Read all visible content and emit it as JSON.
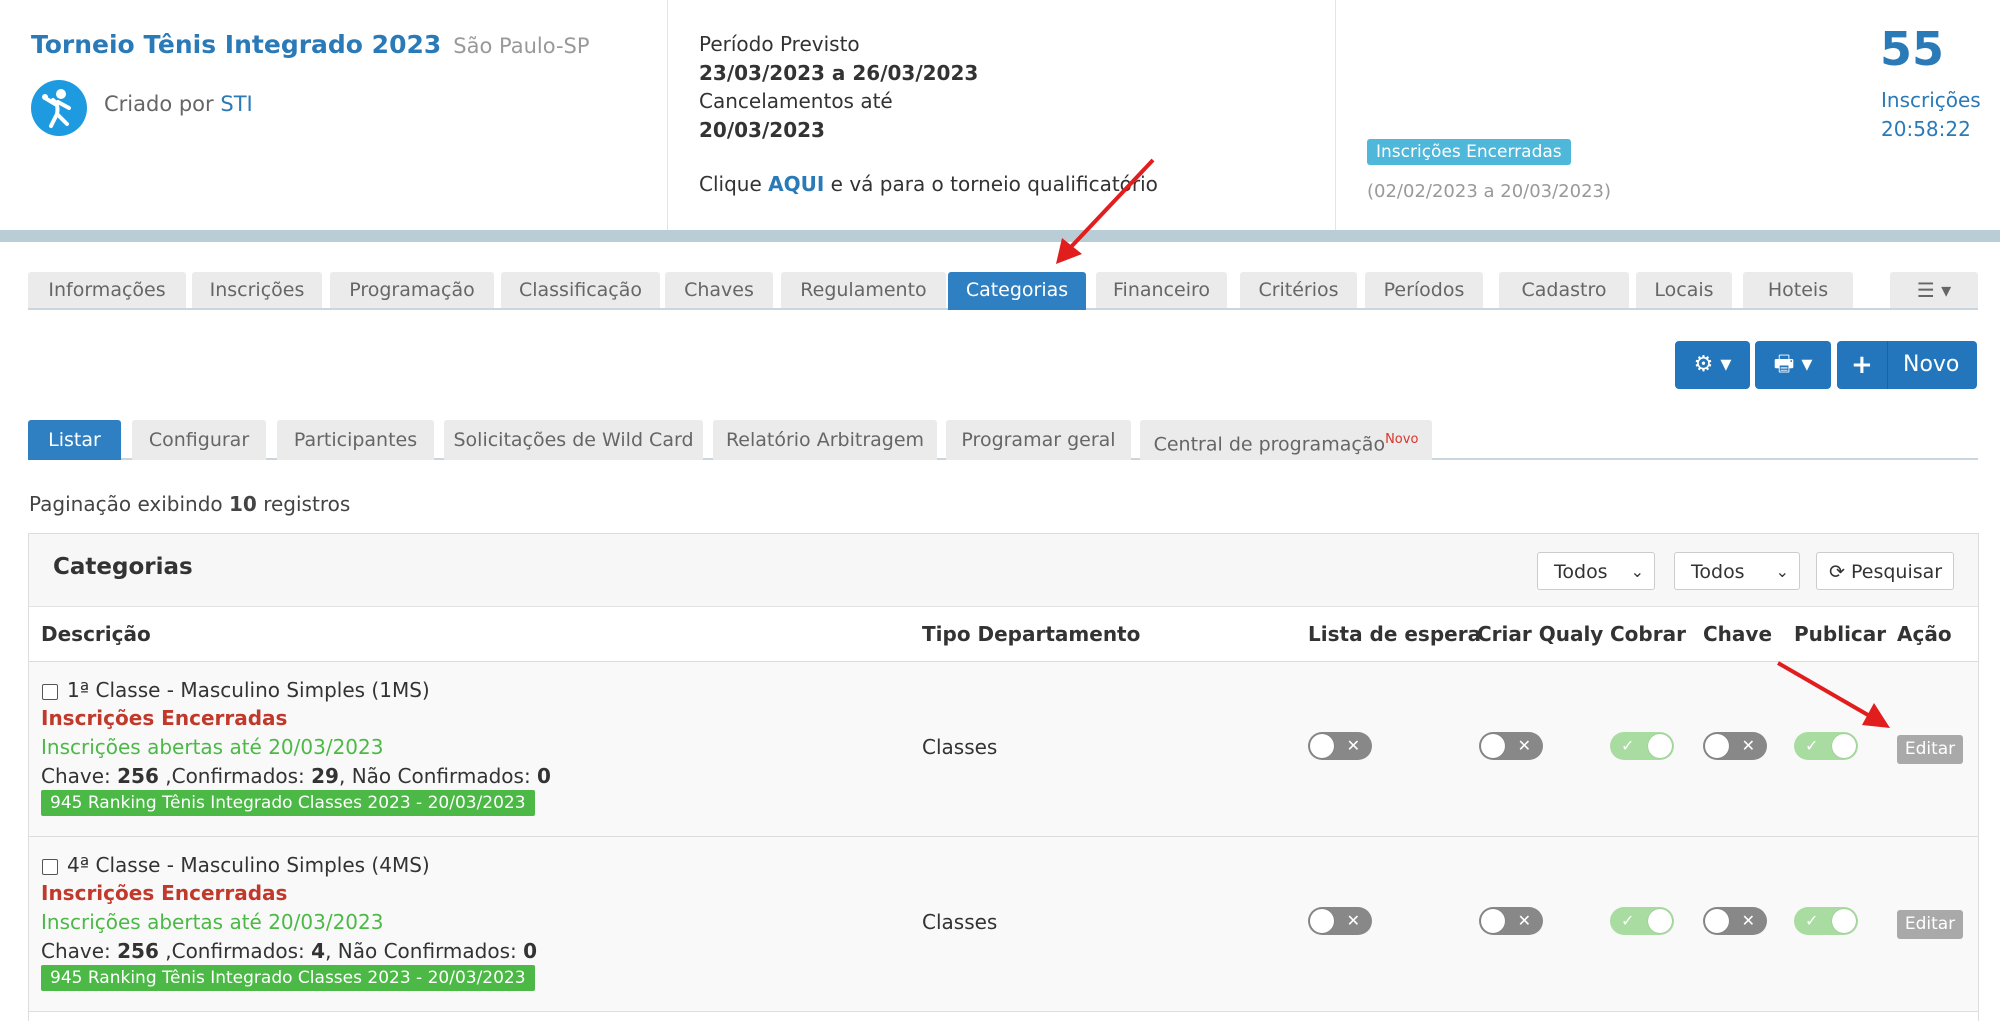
{
  "header": {
    "title": "Torneio Tênis Integrado 2023",
    "city": "São Paulo-SP",
    "created_prefix": "Criado por",
    "created_by": "STI",
    "period_label": "Período Previsto",
    "period_value": "23/03/2023 a 26/03/2023",
    "cancel_label": "Cancelamentos até",
    "cancel_value": "20/03/2023",
    "qualy_prefix": "Clique",
    "qualy_link": "AQUI",
    "qualy_suffix": "e vá para o torneio qualificatório",
    "status_badge": "Inscrições Encerradas",
    "status_range": "(02/02/2023 a 20/03/2023)",
    "registrations_count": "55",
    "registrations_label": "Inscrições",
    "clock": "20:58:22"
  },
  "tabs": [
    {
      "label": "Informações"
    },
    {
      "label": "Inscrições"
    },
    {
      "label": "Programação"
    },
    {
      "label": "Classificação"
    },
    {
      "label": "Chaves"
    },
    {
      "label": "Regulamento"
    },
    {
      "label": "Categorias"
    },
    {
      "label": "Financeiro"
    },
    {
      "label": "Critérios"
    },
    {
      "label": "Períodos"
    },
    {
      "label": "Cadastro"
    },
    {
      "label": "Locais"
    },
    {
      "label": "Hoteis"
    }
  ],
  "menu_tab_icon": "hamburger-menu-icon",
  "actions": {
    "settings_icon": "gear-icon",
    "print_icon": "printer-icon",
    "new_label": "Novo"
  },
  "subtabs": [
    {
      "label": "Listar"
    },
    {
      "label": "Configurar"
    },
    {
      "label": "Participantes"
    },
    {
      "label": "Solicitações de Wild Card"
    },
    {
      "label": "Relatório Arbitragem"
    },
    {
      "label": "Programar geral"
    },
    {
      "label": "Central de programação",
      "badge": "Novo"
    }
  ],
  "pagination": {
    "prefix": "Paginação exibindo",
    "count": "10",
    "suffix": "registros"
  },
  "panel": {
    "title": "Categorias",
    "filter1": "Todos",
    "filter2": "Todos",
    "search_label": "Pesquisar"
  },
  "columns": {
    "descricao": "Descrição",
    "tipo": "Tipo Departamento",
    "lista": "Lista de espera",
    "qualy": "Criar Qualy",
    "cobrar": "Cobrar",
    "chave": "Chave",
    "publicar": "Publicar",
    "acao": "Ação"
  },
  "rows": [
    {
      "name": "1ª Classe - Masculino Simples (1MS)",
      "status": "Inscrições Encerradas",
      "open_until": "Inscrições abertas até 20/03/2023",
      "chave_label": "Chave:",
      "chave": "256",
      "conf_label": ",Confirmados:",
      "confirmados": "29",
      "nconf_label": ", Não Confirmados:",
      "nao_confirmados": "0",
      "ranking": "945 Ranking Tênis Integrado Classes 2023 - 20/03/2023",
      "tipo": "Classes",
      "lista_espera": false,
      "criar_qualy": false,
      "cobrar": true,
      "chave_toggle": false,
      "publicar": true,
      "action": "Editar"
    },
    {
      "name": "4ª Classe - Masculino Simples (4MS)",
      "status": "Inscrições Encerradas",
      "open_until": "Inscrições abertas até 20/03/2023",
      "chave_label": "Chave:",
      "chave": "256",
      "conf_label": ",Confirmados:",
      "confirmados": "4",
      "nconf_label": ", Não Confirmados:",
      "nao_confirmados": "0",
      "ranking": "945 Ranking Tênis Integrado Classes 2023 - 20/03/2023",
      "tipo": "Classes",
      "lista_espera": false,
      "criar_qualy": false,
      "cobrar": true,
      "chave_toggle": false,
      "publicar": true,
      "action": "Editar"
    }
  ],
  "colors": {
    "accent": "#2f80c3",
    "success": "#4cb946",
    "danger": "#c0392b",
    "annotation": "#e21d1d"
  }
}
